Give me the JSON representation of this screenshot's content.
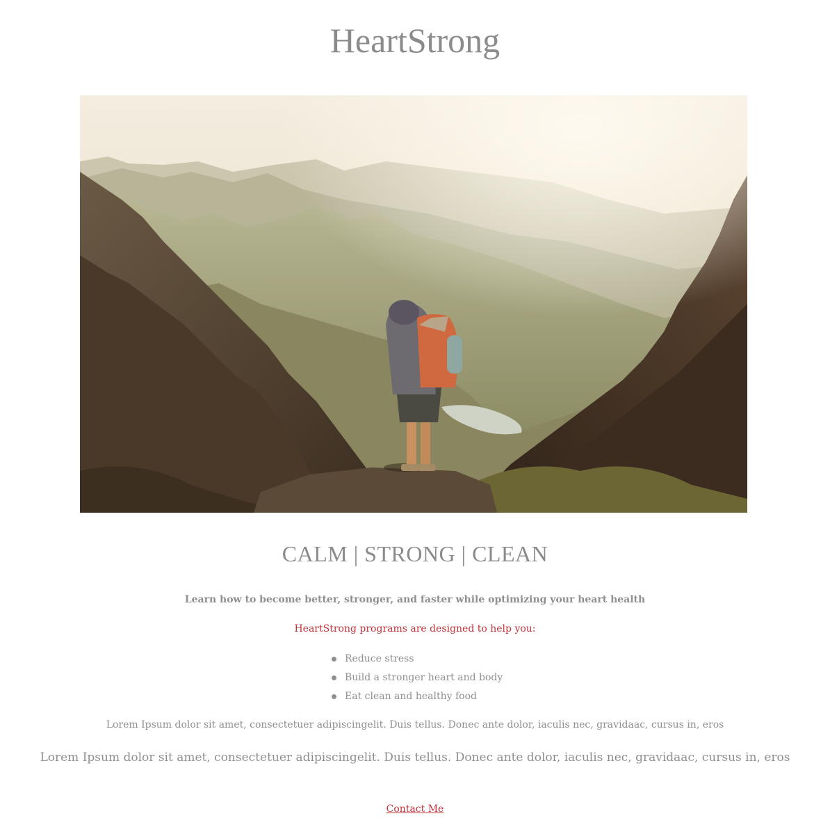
{
  "site": {
    "title": "HeartStrong"
  },
  "hero": {
    "image_alt": "Hiker with backpack standing on a rocky ridge overlooking misty mountains at sunrise"
  },
  "content": {
    "tagline": "CALM | STRONG | CLEAN",
    "lead": "Learn how to become better, stronger, and faster while optimizing your heart health",
    "intro": "HeartStrong programs are designed to help you:",
    "benefits": [
      "Reduce stress",
      "Build a stronger heart and body",
      "Eat clean and healthy food"
    ],
    "lorem_small": "Lorem Ipsum dolor sit amet, consectetuer adipiscingelit. Duis tellus. Donec ante dolor, iaculis nec, gravidaac, cursus in, eros",
    "lorem_large": "Lorem Ipsum dolor sit amet, consectetuer adipiscingelit. Duis tellus. Donec ante dolor, iaculis nec, gravidaac, cursus in, eros"
  },
  "footer": {
    "contact_label": "Contact Me"
  },
  "colors": {
    "text_gray": "#8b8b8b",
    "accent_red": "#c0343a",
    "background": "#ffffff"
  }
}
